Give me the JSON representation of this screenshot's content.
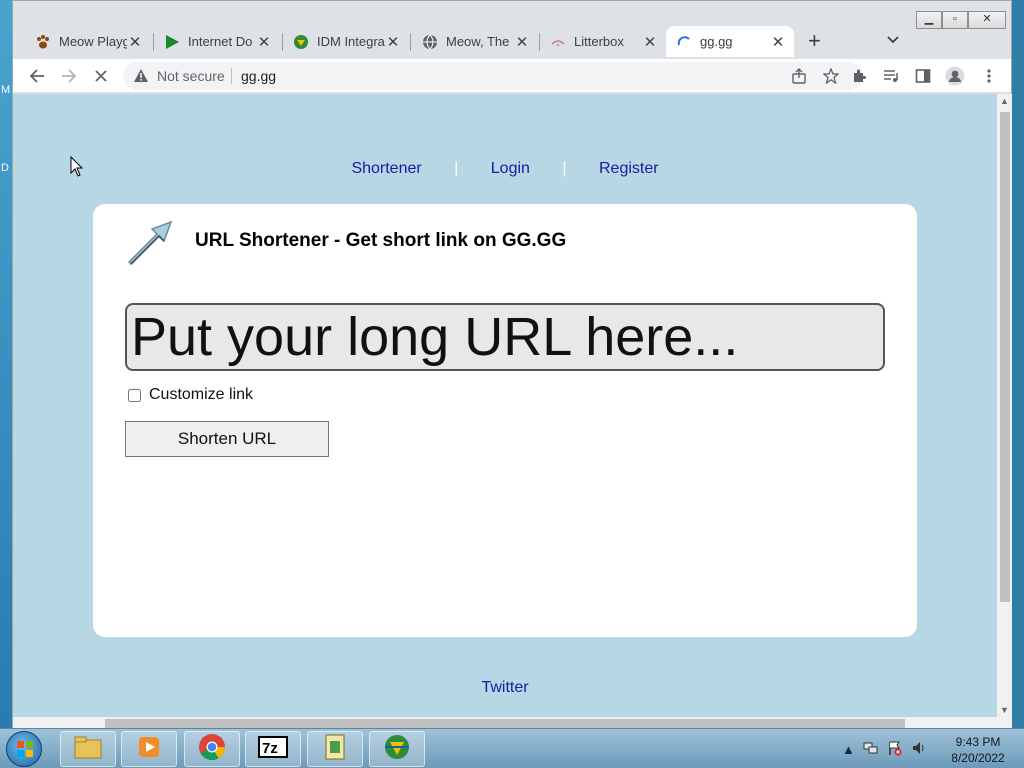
{
  "desktop": {
    "letters": [
      "M",
      "D"
    ]
  },
  "browser": {
    "tabs": [
      {
        "title": "Meow Playg",
        "icon": "paw-icon",
        "active": false
      },
      {
        "title": "Internet Do",
        "icon": "play-icon",
        "active": false
      },
      {
        "title": "IDM Integra",
        "icon": "globe-download-icon",
        "active": false
      },
      {
        "title": "Meow, The",
        "icon": "globe-icon",
        "active": false
      },
      {
        "title": "Litterbox",
        "icon": "litterbox-icon",
        "active": false
      },
      {
        "title": "gg.gg",
        "icon": "loading-icon",
        "active": true
      }
    ],
    "tab_close": "✕",
    "new_tab": "+",
    "address": {
      "security_text": "Not secure",
      "url": "gg.gg"
    }
  },
  "page": {
    "nav": {
      "shortener": "Shortener",
      "login": "Login",
      "register": "Register",
      "separator": "|"
    },
    "heading": "URL Shortener - Get short link on GG.GG",
    "url_input_placeholder": "Put your long URL here...",
    "customize_label": "Customize link",
    "customize_checked": false,
    "shorten_button": "Shorten URL",
    "footer_link": "Twitter",
    "colors": {
      "background": "#b7d7e4",
      "link": "#1a1aa6",
      "card": "#ffffff"
    }
  },
  "taskbar": {
    "apps": [
      "file-explorer-icon",
      "media-player-icon",
      "chrome-icon",
      "7zip-icon",
      "doc-manager-icon",
      "idm-icon"
    ],
    "clock": {
      "time": "9:43 PM",
      "date": "8/20/2022"
    }
  }
}
